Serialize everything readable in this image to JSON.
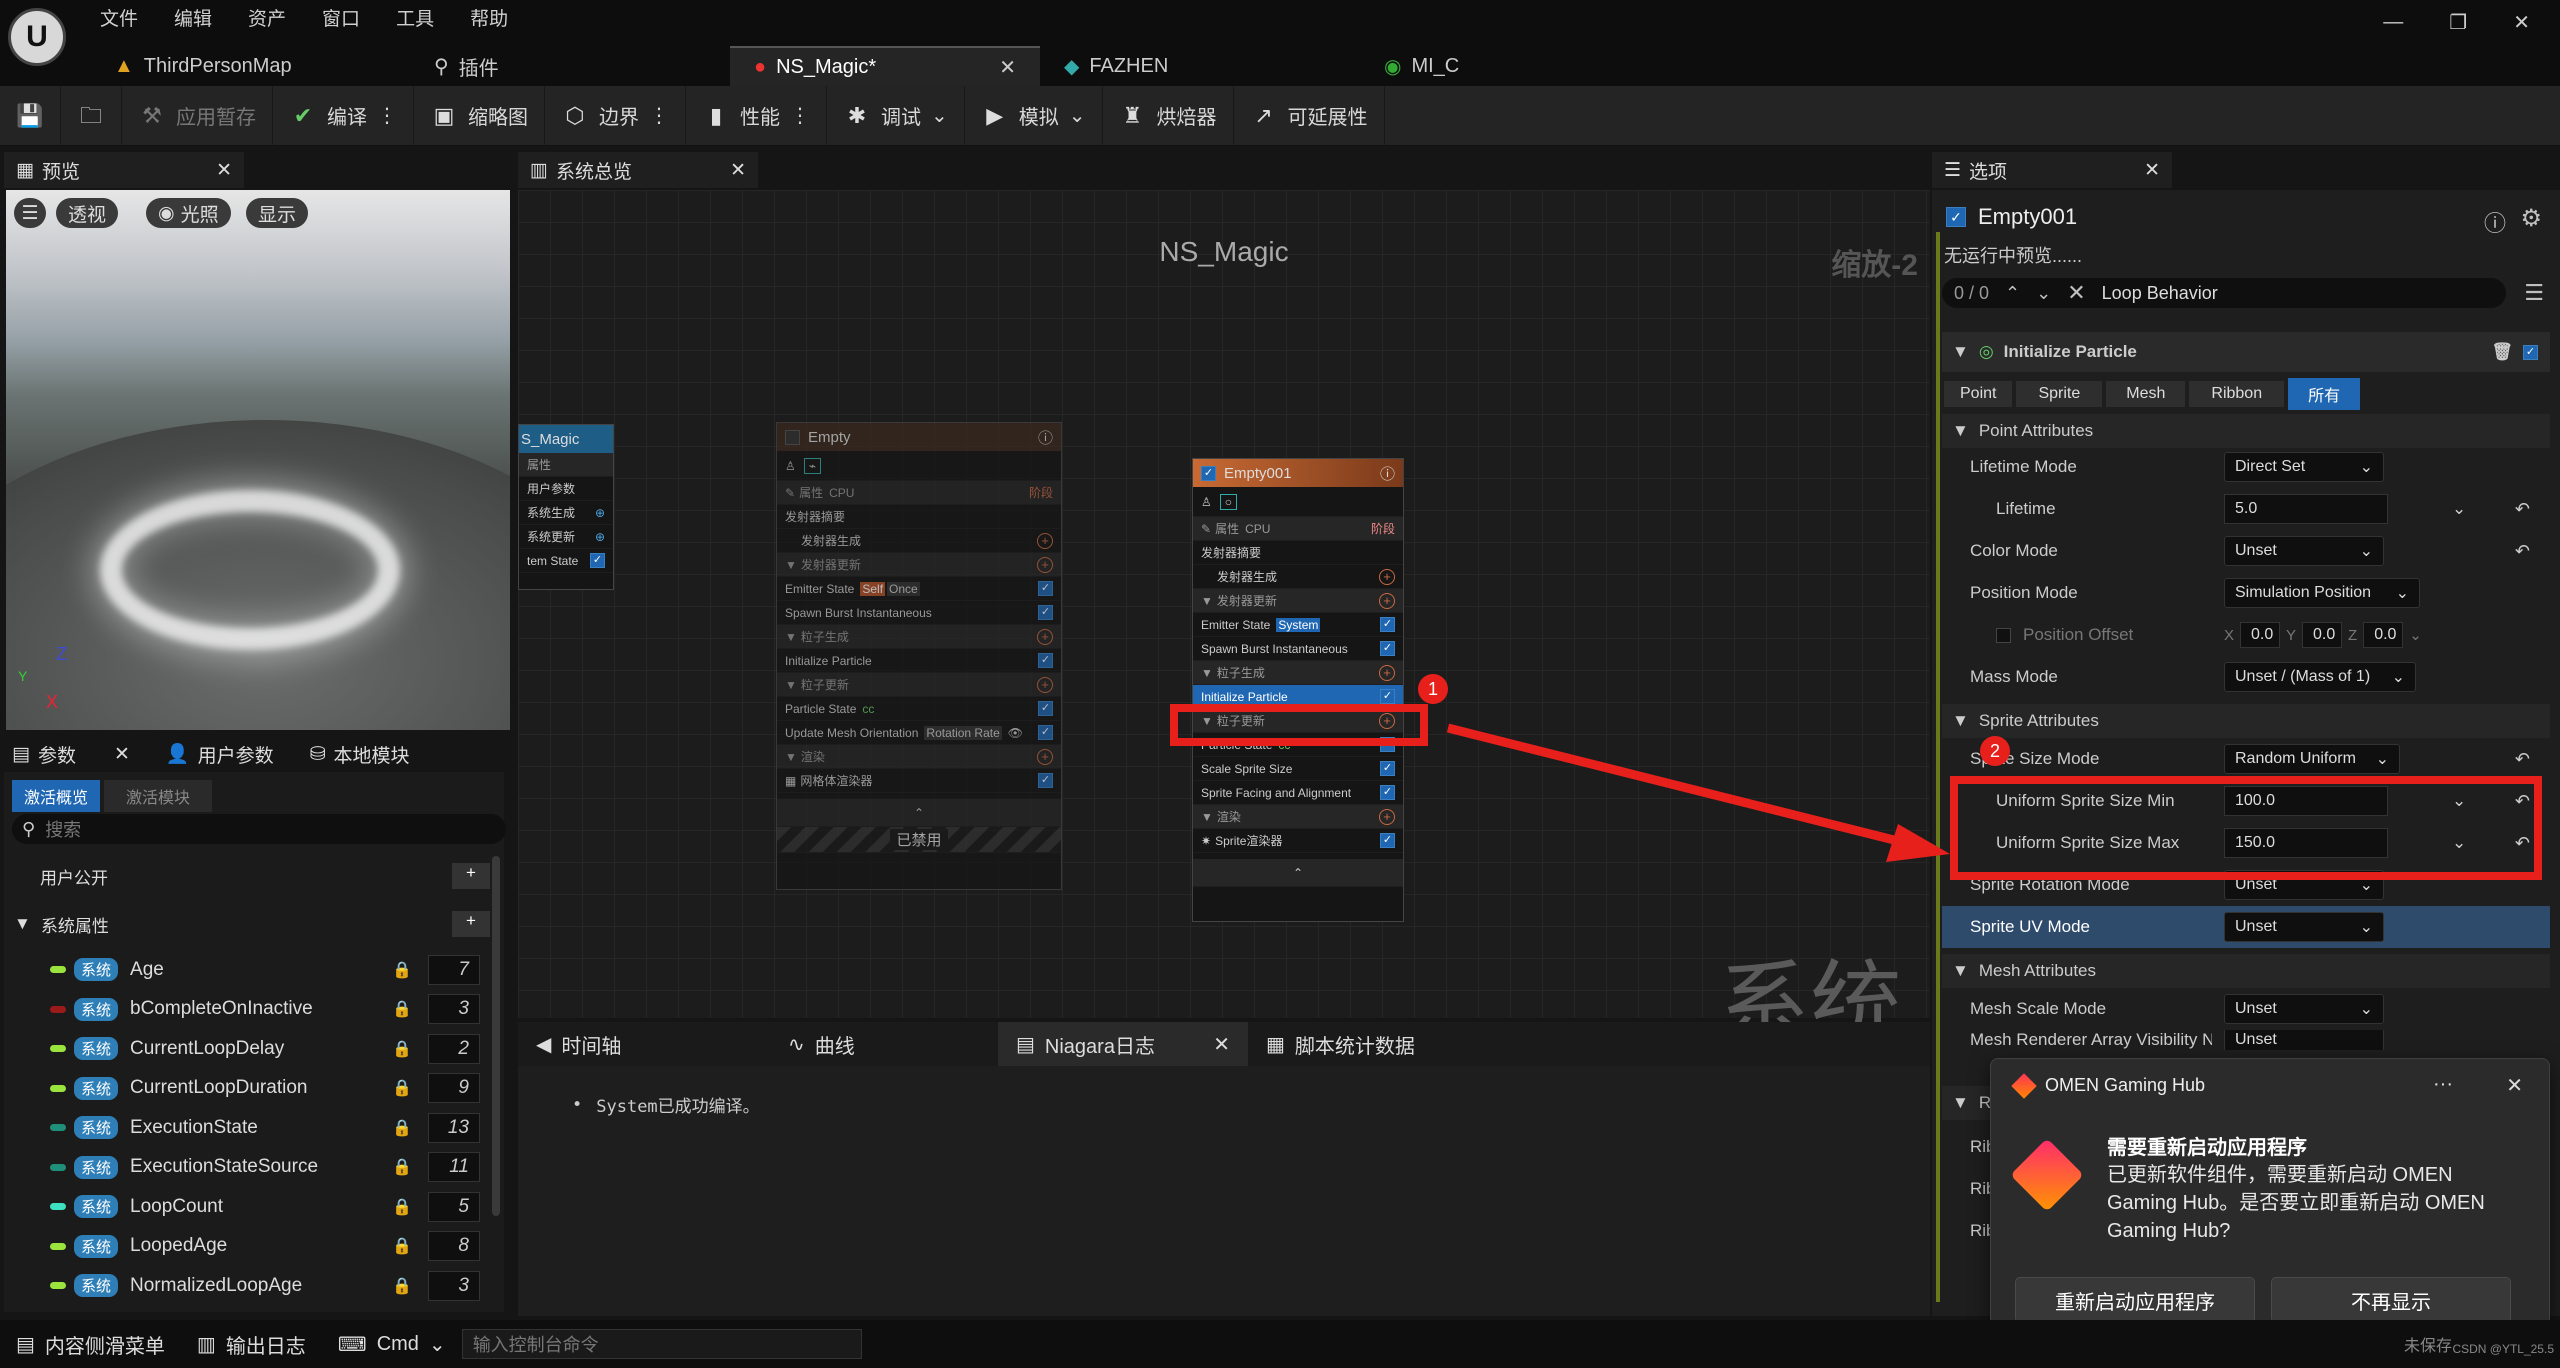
{
  "menu": [
    "文件",
    "编辑",
    "资产",
    "窗口",
    "工具",
    "帮助"
  ],
  "window_controls": [
    "—",
    "❐",
    "✕"
  ],
  "editor_tabs": [
    {
      "label": "ThirdPersonMap",
      "icon": "map-icon"
    },
    {
      "label": "插件",
      "icon": "plugin-icon"
    },
    {
      "label": "NS_Magic*",
      "icon": "niagara-icon",
      "close": "✕"
    },
    {
      "label": "FAZHEN",
      "icon": "material-icon"
    },
    {
      "label": "MI_C",
      "icon": "material-instance-icon"
    }
  ],
  "toolbar": {
    "apply_pending": "应用暂存",
    "compile": "编译",
    "thumbnail": "缩略图",
    "bounds": "边界",
    "performance": "性能",
    "debug": "调试",
    "simulate": "模拟",
    "baker": "烘焙器",
    "scalability": "可延展性"
  },
  "preview": {
    "tab": "预览",
    "close": "✕",
    "perspective": "透视",
    "lighting": "光照",
    "show": "显示",
    "axis_z": "Z",
    "axis_x": "X",
    "axis_y": "Y"
  },
  "params_panel": {
    "tabs": [
      "参数",
      "用户参数",
      "本地模块"
    ],
    "close": "✕",
    "subtabs": [
      "激活概览",
      "激活模块"
    ],
    "search_placeholder": "搜索",
    "user_exposed": "用户公开",
    "system_props": "系统属性",
    "sys_tag": "系统",
    "rows": [
      {
        "name": "Age",
        "value": "7",
        "color": "#9be33d"
      },
      {
        "name": "bCompleteOnInactive",
        "value": "3",
        "color": "#9b1b1b"
      },
      {
        "name": "CurrentLoopDelay",
        "value": "2",
        "color": "#9be33d"
      },
      {
        "name": "CurrentLoopDuration",
        "value": "9",
        "color": "#9be33d"
      },
      {
        "name": "ExecutionState",
        "value": "13",
        "color": "#1f8f7a"
      },
      {
        "name": "ExecutionStateSource",
        "value": "11",
        "color": "#1f8f7a"
      },
      {
        "name": "LoopCount",
        "value": "5",
        "color": "#3de0c0"
      },
      {
        "name": "LoopedAge",
        "value": "8",
        "color": "#9be33d"
      },
      {
        "name": "NormalizedLoopAge",
        "value": "3",
        "color": "#9be33d"
      }
    ]
  },
  "graph": {
    "tab": "系统总览",
    "close": "✕",
    "title": "NS_Magic",
    "zoom": "缩放-2",
    "watermark": "系统",
    "node_sys": {
      "title": "S_Magic",
      "rows": [
        "属性",
        "用户参数",
        "系统生成",
        "系统更新",
        "tem State"
      ]
    },
    "node_empty": {
      "title": "Empty",
      "cpu": "CPU",
      "props": "属性",
      "stage": "阶段",
      "rows": [
        "发射器摘要",
        "发射器生成",
        "发射器更新",
        "Emitter State",
        "Spawn Burst Instantaneous",
        "粒子生成",
        "Initialize Particle",
        "粒子更新",
        "Particle State",
        "Update Mesh Orientation",
        "渲染",
        "网格体渲染器"
      ],
      "tags": {
        "self": "Self",
        "once": "Once",
        "rotation_rate": "Rotation Rate",
        "cc": "cc"
      },
      "disabled": "已禁用"
    },
    "node_empty001": {
      "title": "Empty001",
      "cpu": "CPU",
      "props": "属性",
      "stage": "阶段",
      "rows": [
        "发射器摘要",
        "发射器生成",
        "发射器更新",
        "Emitter State",
        "Spawn Burst Instantaneous",
        "粒子生成",
        "Initialize Particle",
        "粒子更新",
        "Particle State",
        "Scale Sprite Size",
        "Sprite Facing and Alignment",
        "渲染",
        "Sprite渲染器"
      ],
      "tags": {
        "system": "System",
        "cc": "cc"
      }
    }
  },
  "bottom_tabs": [
    "时间轴",
    "曲线",
    "Niagara日志",
    "脚本统计数据"
  ],
  "log_line": "System已成功编译。",
  "details": {
    "tab": "选项",
    "close": "✕",
    "emitter": "Empty001",
    "no_preview": "无运行中预览......",
    "search_count": "0 / 0",
    "search_value": "Loop Behavior",
    "module": "Initialize Particle",
    "filters": [
      "Point",
      "Sprite",
      "Mesh",
      "Ribbon",
      "所有"
    ],
    "point_attributes": "Point Attributes",
    "lifetime_mode": {
      "label": "Lifetime Mode",
      "value": "Direct Set"
    },
    "lifetime": {
      "label": "Lifetime",
      "value": "5.0"
    },
    "color_mode": {
      "label": "Color Mode",
      "value": "Unset"
    },
    "position_mode": {
      "label": "Position Mode",
      "value": "Simulation Position"
    },
    "position_offset": {
      "label": "Position Offset",
      "x": "0.0",
      "y": "0.0",
      "z": "0.0"
    },
    "mass_mode": {
      "label": "Mass Mode",
      "value": "Unset / (Mass of 1)"
    },
    "sprite_attributes": "Sprite Attributes",
    "sprite_size_mode": {
      "label": "Sprite Size Mode",
      "value": "Random Uniform"
    },
    "size_min": {
      "label": "Uniform Sprite Size Min",
      "value": "100.0"
    },
    "size_max": {
      "label": "Uniform Sprite Size Max",
      "value": "150.0"
    },
    "rotation_mode": {
      "label": "Sprite Rotation Mode",
      "value": "Unset"
    },
    "uv_mode": {
      "label": "Sprite UV Mode",
      "value": "Unset"
    },
    "mesh_attributes": "Mesh Attributes",
    "mesh_scale_mode": {
      "label": "Mesh Scale Mode",
      "value": "Unset"
    },
    "mesh_vis": {
      "label": "Mesh Renderer Array Visibility N",
      "value": "Unset"
    },
    "rib_short": "Rib"
  },
  "notification": {
    "app": "OMEN Gaming Hub",
    "more": "···",
    "close": "✕",
    "title": "需要重新启动应用程序",
    "body": "已更新软件组件，需要重新启动 OMEN Gaming Hub。是否要立即重新启动 OMEN Gaming Hub?",
    "restart": "重新启动应用程序",
    "dont_show": "不再显示"
  },
  "statusbar": {
    "content_drawer": "内容侧滑菜单",
    "output_log": "输出日志",
    "cmd": "Cmd",
    "cmd_placeholder": "输入控制台命令",
    "save": "未保存",
    "credit": "CSDN @YTL_25.5"
  },
  "annotations": {
    "badge1": "1",
    "badge2": "2"
  },
  "colors": {
    "accent": "#1f66b3",
    "highlight": "#e8201c",
    "selected_row": "#2f4b6c",
    "node_orange": "#c86a34"
  }
}
